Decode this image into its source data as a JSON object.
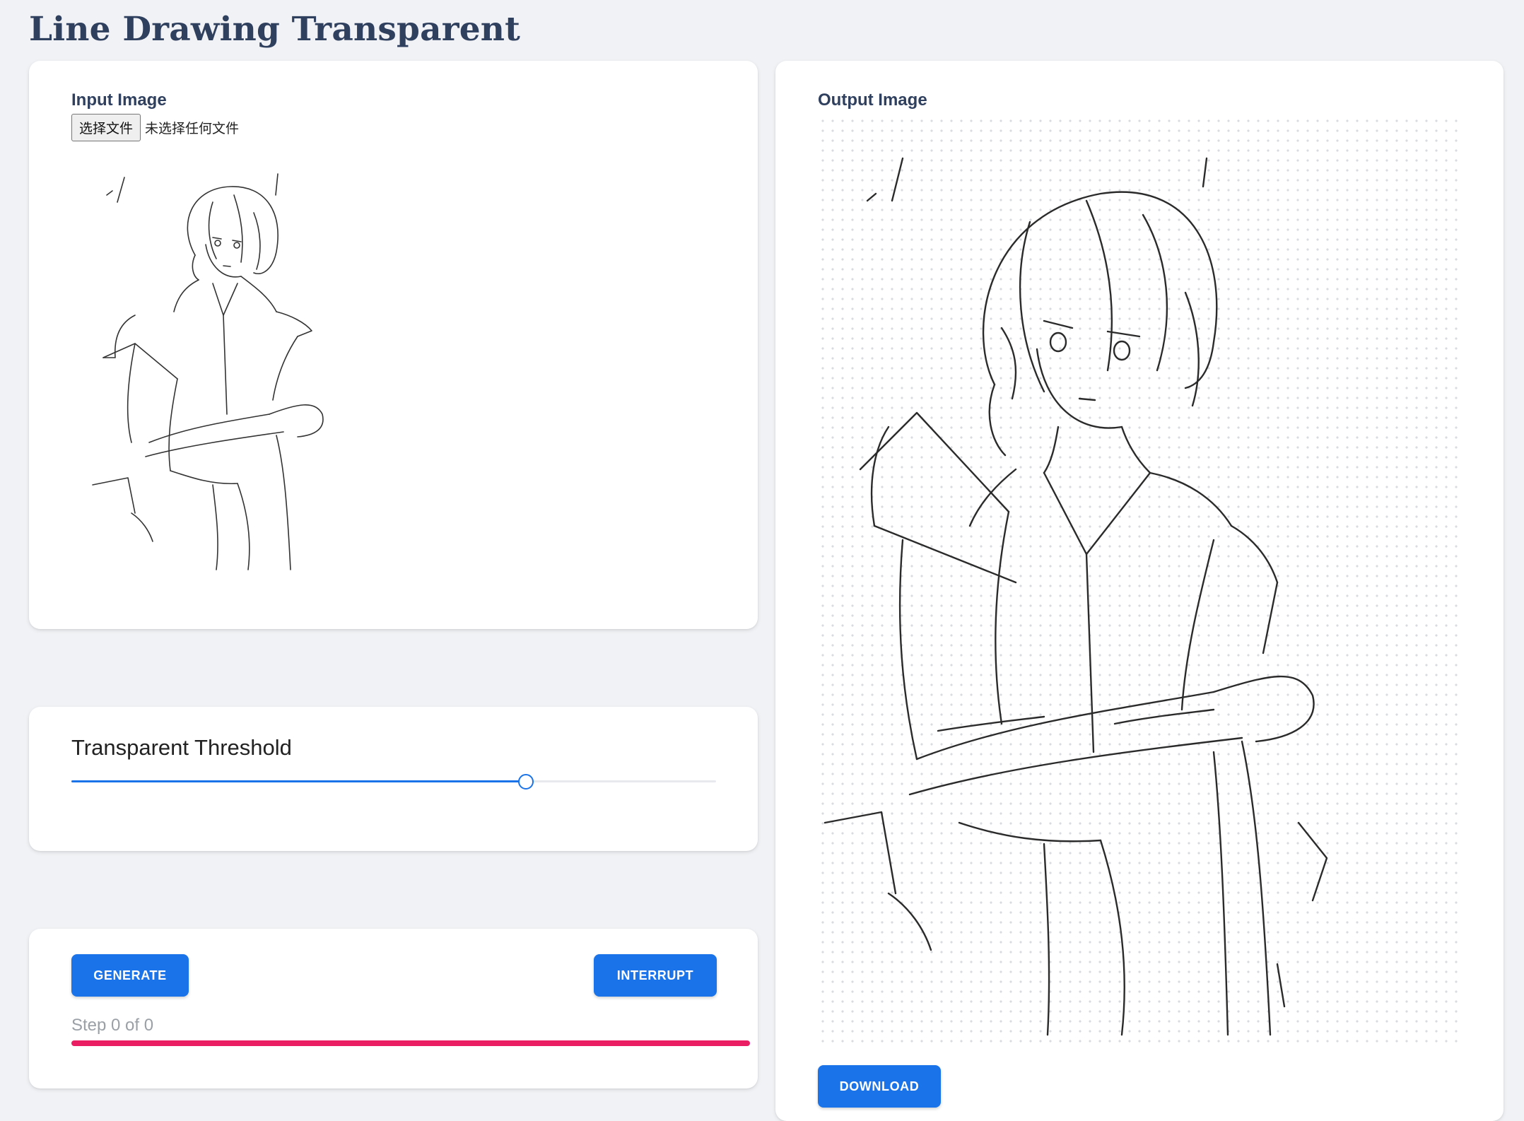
{
  "page": {
    "title": "Line Drawing Transparent"
  },
  "input": {
    "label": "Input Image",
    "choose_file_label": "选择文件",
    "no_file_text": "未选择任何文件"
  },
  "threshold": {
    "label": "Transparent Threshold",
    "value_fraction": 0.705
  },
  "controls": {
    "generate_label": "GENERATE",
    "interrupt_label": "INTERRUPT",
    "step_text": "Step 0 of 0",
    "progress_fraction": 1.0
  },
  "output": {
    "label": "Output Image",
    "download_label": "DOWNLOAD"
  },
  "colors": {
    "accent": "#1a73e8",
    "progress": "#e91e63",
    "title": "#2f3f5e",
    "background": "#f0f2f5"
  }
}
